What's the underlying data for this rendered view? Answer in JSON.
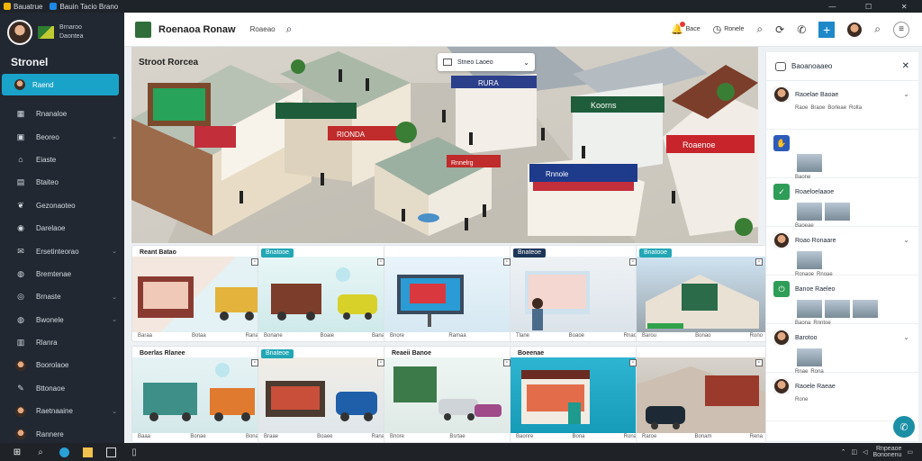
{
  "os_bar": {
    "tabs": [
      {
        "label": "Bauatrue",
        "icon": "app-icon",
        "color": "#f2b705"
      },
      {
        "label": "Bauin Tacio Brano",
        "icon": "browser-icon",
        "color": "#1e88e5"
      }
    ],
    "controls": [
      "minimize-icon",
      "maximize-icon",
      "close-icon"
    ]
  },
  "sidebar": {
    "profile": {
      "line1": "Brnaroo",
      "line2": "Daontea"
    },
    "section_title": "Stronel",
    "active_item": {
      "label": "Raend",
      "icon": "user-icon"
    },
    "items": [
      {
        "label": "Rnanaloe",
        "icon": "grid-icon",
        "chevron": false
      },
      {
        "label": "Beoreo",
        "icon": "image-icon",
        "chevron": true
      },
      {
        "label": "Eiaste",
        "icon": "store-icon",
        "chevron": false
      },
      {
        "label": "Btaiteo",
        "icon": "bus-icon",
        "chevron": false
      },
      {
        "label": "Gezonaoteo",
        "icon": "leaf-icon",
        "chevron": false
      },
      {
        "label": "Darelaoe",
        "icon": "palette-icon",
        "chevron": false
      },
      {
        "label": "Ersetinteorao",
        "icon": "chat-icon",
        "chevron": true
      },
      {
        "label": "Bremtenae",
        "icon": "globe-icon",
        "chevron": false
      },
      {
        "label": "Brnaste",
        "icon": "earth-icon",
        "chevron": true
      },
      {
        "label": "Bwonele",
        "icon": "globe-icon",
        "chevron": true
      },
      {
        "label": "Rlanra",
        "icon": "chart-icon",
        "chevron": false
      },
      {
        "label": "Boorolaoe",
        "icon": "avatar-icon",
        "chevron": false
      },
      {
        "label": "Bttonaoe",
        "icon": "pencil-icon",
        "chevron": false
      },
      {
        "label": "Raetnaaine",
        "icon": "avatar-icon",
        "chevron": true
      },
      {
        "label": "Rannere",
        "icon": "avatar-icon",
        "chevron": false
      }
    ]
  },
  "header": {
    "title": "Roenaoa Ronaw",
    "subtitle": "Roaeao",
    "icons": [
      {
        "name": "notification-icon",
        "label": "Bace"
      },
      {
        "name": "clock-icon",
        "label": "Ronele"
      },
      {
        "name": "search-icon",
        "label": ""
      },
      {
        "name": "sync-icon",
        "label": ""
      },
      {
        "name": "whatsapp-icon",
        "label": ""
      }
    ]
  },
  "hero": {
    "label": "Stroot Rorcea",
    "dropdown_value": "Stneo Laoeo",
    "signs": [
      "RIONDA",
      "Koorns",
      "Rnnelrg",
      "Roaenoe",
      "Rnnole",
      "RURA"
    ]
  },
  "cards": [
    {
      "tag": "Reant Batao",
      "tag_style": "plain",
      "scene": "kiosk-truck",
      "foot_left": "Baraa",
      "foot_mid": "Botaa",
      "foot_right": "Rana"
    },
    {
      "tag": "Bnatooe",
      "tag_style": "teal",
      "scene": "van-car",
      "foot_left": "Bonane",
      "foot_mid": "Boaie",
      "foot_right": "Bana"
    },
    {
      "tag": "",
      "tag_style": "plain",
      "scene": "billboard",
      "foot_left": "Bnore",
      "foot_mid": "Ramaa",
      "foot_right": ""
    },
    {
      "tag": "Bnateoe",
      "tag_style": "dark",
      "scene": "person-screen",
      "foot_left": "Tlane",
      "foot_mid": "Boaoe",
      "foot_right": "Rnao"
    },
    {
      "tag": "Bnatooe",
      "tag_style": "teal",
      "scene": "plaza",
      "foot_left": "Barou",
      "foot_mid": "Bonao",
      "foot_right": "Rono"
    },
    {
      "tag": "Boerlas Rlanee",
      "tag_style": "plain",
      "scene": "vans",
      "foot_left": "Baaa",
      "foot_mid": "Bonae",
      "foot_right": "Bona"
    },
    {
      "tag": "Bnateoe",
      "tag_style": "teal",
      "scene": "stall-car",
      "foot_left": "Braae",
      "foot_mid": "Boaee",
      "foot_right": "Rana"
    },
    {
      "tag": "Reaeii Banoe",
      "tag_style": "plain",
      "scene": "gas-station",
      "foot_left": "Bnore",
      "foot_mid": "Bsrtae",
      "foot_right": ""
    },
    {
      "tag": "Boeenae",
      "tag_style": "plain",
      "scene": "shop-kiosk",
      "foot_left": "Baonre",
      "foot_mid": "Bona",
      "foot_right": "Rona"
    },
    {
      "tag": "",
      "tag_style": "plain",
      "scene": "street-car",
      "foot_left": "Raroe",
      "foot_mid": "Bonam",
      "foot_right": "Rena"
    }
  ],
  "right_panel": {
    "title": "Baoanoaaeo",
    "items": [
      {
        "title": "Raoelae Baoae",
        "sub": [
          "Raoe",
          "Braoe",
          "Borleae",
          "Rolta"
        ],
        "icon": "avatar-icon",
        "icon_color": "#f5f5f5",
        "thumbs": 0,
        "chevron": true
      },
      {
        "title": "",
        "sub": [
          "Baone"
        ],
        "icon": "hand-icon",
        "icon_color": "#2d5bba",
        "thumbs": 1,
        "chevron": false
      },
      {
        "title": "Roaeloelaaoe",
        "sub": [
          "Baoeae"
        ],
        "icon": "check-icon",
        "icon_color": "#2e9d57",
        "thumbs": 2,
        "chevron": false
      },
      {
        "title": "Roao Ronaare",
        "sub": [
          "Ronaoe",
          "Rnoae"
        ],
        "icon": "avatar-icon",
        "icon_color": "#f5f5f5",
        "thumbs": 1,
        "chevron": true
      },
      {
        "title": "Banoe Raeleo",
        "sub": [
          "Baona",
          "Rnntoe"
        ],
        "icon": "power-icon",
        "icon_color": "#2e9d57",
        "thumbs": 3,
        "chevron": false
      },
      {
        "title": "Barotoo",
        "sub": [
          "Rnae",
          "Rona"
        ],
        "icon": "avatar-icon",
        "icon_color": "#f5f5f5",
        "thumbs": 1,
        "chevron": true
      },
      {
        "title": "Raoele Raeae",
        "sub": [
          "Rone"
        ],
        "icon": "avatar-icon",
        "icon_color": "#f5f5f5",
        "thumbs": 0,
        "chevron": false
      }
    ]
  },
  "taskbar": {
    "clock_time": "Rnpeaoe",
    "clock_date": "Bononenu",
    "icons": [
      "start-icon",
      "search-icon",
      "browser-icon",
      "folder-icon",
      "terminal-icon",
      "book-icon"
    ]
  },
  "colors": {
    "accent": "#1aa3c9",
    "sidebar": "#222831",
    "teal_tag": "#22a7b5"
  }
}
